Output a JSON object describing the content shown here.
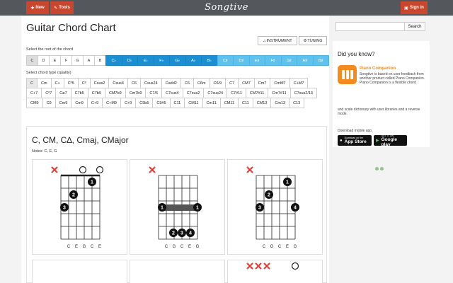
{
  "topbar": {
    "new_label": "New",
    "tools_label": "Tools",
    "logo": "Songtive",
    "signin_label": "Sign in"
  },
  "main": {
    "title": "Guitar Chord Chart",
    "instrument_label": "INSTRUMENT",
    "tuning_label": "TUNING",
    "root_label": "Select the root of the chord",
    "type_label": "Select chord type (quality)",
    "roots": [
      {
        "label": "C",
        "kind": "sel"
      },
      {
        "label": "D",
        "kind": "plain"
      },
      {
        "label": "E",
        "kind": "plain"
      },
      {
        "label": "F",
        "kind": "plain"
      },
      {
        "label": "G",
        "kind": "plain"
      },
      {
        "label": "A",
        "kind": "plain"
      },
      {
        "label": "B",
        "kind": "plain"
      },
      {
        "label": "C♭",
        "kind": "flat"
      },
      {
        "label": "D♭",
        "kind": "flat"
      },
      {
        "label": "E♭",
        "kind": "flat"
      },
      {
        "label": "F♭",
        "kind": "flat"
      },
      {
        "label": "G♭",
        "kind": "flat"
      },
      {
        "label": "A♭",
        "kind": "flat"
      },
      {
        "label": "B♭",
        "kind": "flat"
      },
      {
        "label": "C♯",
        "kind": "sharp"
      },
      {
        "label": "D♯",
        "kind": "sharp"
      },
      {
        "label": "E♯",
        "kind": "sharp"
      },
      {
        "label": "F♯",
        "kind": "sharp"
      },
      {
        "label": "G♯",
        "kind": "sharp"
      },
      {
        "label": "A♯",
        "kind": "sharp"
      },
      {
        "label": "B♯",
        "kind": "sharp"
      }
    ],
    "types": [
      "C",
      "Cm",
      "C+",
      "Cº5",
      "Cº",
      "Csus2",
      "Csus4",
      "C6",
      "Csus24",
      "Cadd2",
      "C6",
      "C6m",
      "C6/9",
      "C7",
      "CM7",
      "Cm7",
      "CmM7",
      "C+M7",
      "C+7",
      "Cº7",
      "C⌀7",
      "C7b5",
      "C7b9",
      "CM7b9",
      "Cm7b9",
      "C7/6",
      "C7sus4",
      "C7sus2",
      "C7sus24",
      "C7#11",
      "CM7#11",
      "Cm7#11",
      "C7sus2/13",
      "CM9",
      "C9",
      "Cm9",
      "Cm9",
      "C+9",
      "C+M9",
      "C+9",
      "C9b5",
      "C9#5",
      "C11",
      "CM11",
      "Cm11",
      "CM11",
      "C11",
      "CM13",
      "Cm13",
      "C13"
    ],
    "chord_heading": "C, CM, C∆, Cmaj, CMajor",
    "notes_line": "Notes: C, E, G",
    "cards": [
      {
        "strings": [
          "C",
          "E",
          "G",
          "C",
          "E"
        ]
      },
      {
        "strings": [
          "C",
          "G",
          "C",
          "E",
          "G"
        ]
      },
      {
        "strings": [
          "C",
          "G",
          "C",
          "E",
          "G"
        ]
      }
    ]
  },
  "sidebar": {
    "search_placeholder": "",
    "search_button": "Search",
    "did_you_know": "Did you know?",
    "app_title": "Piano Companion",
    "app_text_1": "Songtive is based on user feedback from another product called Piano Companion. Piano Companion is a flexible chord",
    "app_text_2": "and scale dictionary with user libraries and a reverse mode.",
    "download_label": "Download mobile app",
    "appstore_small": "Download on the",
    "appstore_big": "App Store",
    "googleplay_small": "GET IT ON",
    "googleplay_big": "Google play"
  },
  "colors": {
    "accent": "#c8472e",
    "flat_blue": "#1b8fd1",
    "sharp_blue": "#5ec2ec",
    "app_orange": "#f38b1e",
    "mute_red": "#e53935"
  }
}
